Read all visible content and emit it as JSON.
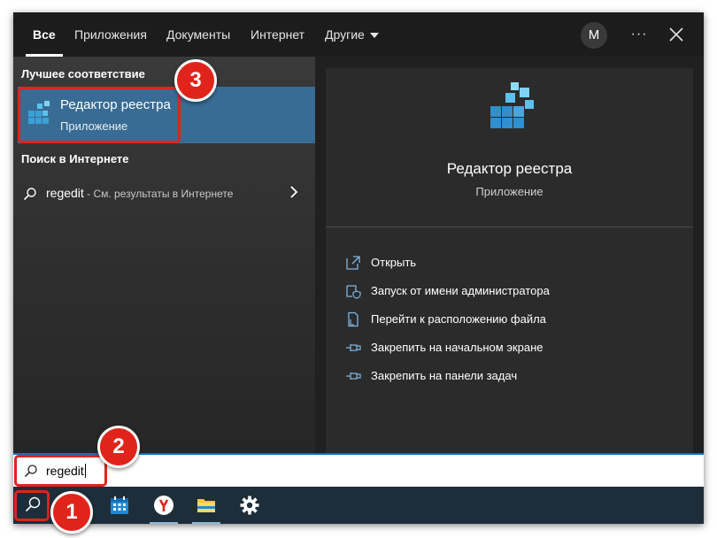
{
  "tabs": [
    {
      "label": "Все",
      "active": true
    },
    {
      "label": "Приложения"
    },
    {
      "label": "Документы"
    },
    {
      "label": "Интернет"
    },
    {
      "label": "Другие"
    }
  ],
  "header": {
    "avatar_initial": "M",
    "more_label": "···"
  },
  "left": {
    "best_match_heading": "Лучшее соответствие",
    "best_match": {
      "title": "Редактор реестра",
      "subtitle": "Приложение"
    },
    "web_heading": "Поиск в Интернете",
    "web_result": {
      "query": "regedit",
      "hint": " - См. результаты в Интернете"
    }
  },
  "preview": {
    "title": "Редактор реестра",
    "subtitle": "Приложение",
    "actions": [
      {
        "label": "Открыть",
        "icon": "open-icon"
      },
      {
        "label": "Запуск от имени администратора",
        "icon": "shield-icon"
      },
      {
        "label": "Перейти к расположению файла",
        "icon": "file-location-icon"
      },
      {
        "label": "Закрепить на начальном экране",
        "icon": "pin-icon"
      },
      {
        "label": "Закрепить на панели задач",
        "icon": "pin-icon"
      }
    ]
  },
  "search": {
    "value": "regedit"
  },
  "taskbar": {
    "items": [
      "search-icon",
      "calendar-icon",
      "yandex-browser-icon",
      "file-explorer-icon",
      "settings-gear-icon"
    ]
  },
  "badges": [
    "1",
    "2",
    "3"
  ],
  "colors": {
    "accent": "#386c94",
    "highlight": "#e0241b",
    "panel": "#202020",
    "taskbar": "#1d2e3a"
  }
}
